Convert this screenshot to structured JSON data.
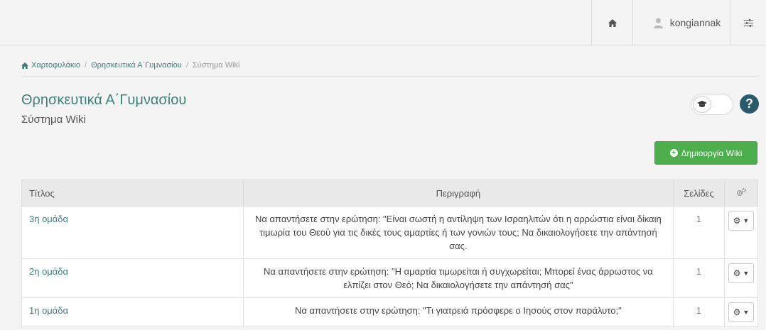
{
  "header": {
    "home_icon": "home-icon",
    "user_icon": "user-icon",
    "username": "kongiannak",
    "settings_icon": "sliders-icon"
  },
  "breadcrumb": {
    "items": [
      "Χαρτοφυλάκιο",
      "Θρησκευτικά Α΄Γυμνασίου",
      "Σύστημα Wiki"
    ]
  },
  "page": {
    "title": "Θρησκευτικά Α΄Γυμνασίου",
    "subtitle": "Σύστημα Wiki",
    "create_label": "Δημιουργία Wiki"
  },
  "table": {
    "headers": [
      "Τίτλος",
      "Περιγραφή",
      "Σελίδες"
    ],
    "rows": [
      {
        "title": "3η ομάδα",
        "description": "Να απαντήσετε στην ερώτηση: \"Είναι σωστή η αντίληψη των Ισραηλιτών ότι η αρρώστια είναι δίκαιη τιμωρία του Θεού για τις δικές τους αμαρτίες ή των γονιών τους; Να δικαιολογήσετε την απάντησή σας.",
        "pages": "1"
      },
      {
        "title": "2η ομάδα",
        "description": "Να απαντήσετε στην ερώτηση: \"Η αμαρτία τιμωρείται ή συγχωρείται; Μπορεί ένας άρρωστος να ελπίζει στον Θεό; Να δικαιολογήσετε την απάντησή σας\"",
        "pages": "1"
      },
      {
        "title": "1η ομάδα",
        "description": "Να απαντήσετε στην ερώτηση: \"Τι γιατρειά πρόσφερε ο Ιησούς στον παράλυτο;\"",
        "pages": "1"
      }
    ]
  },
  "colors": {
    "accent": "#3f7f7a",
    "create_button": "#4cae4c",
    "help_button": "#2b5a6d"
  }
}
